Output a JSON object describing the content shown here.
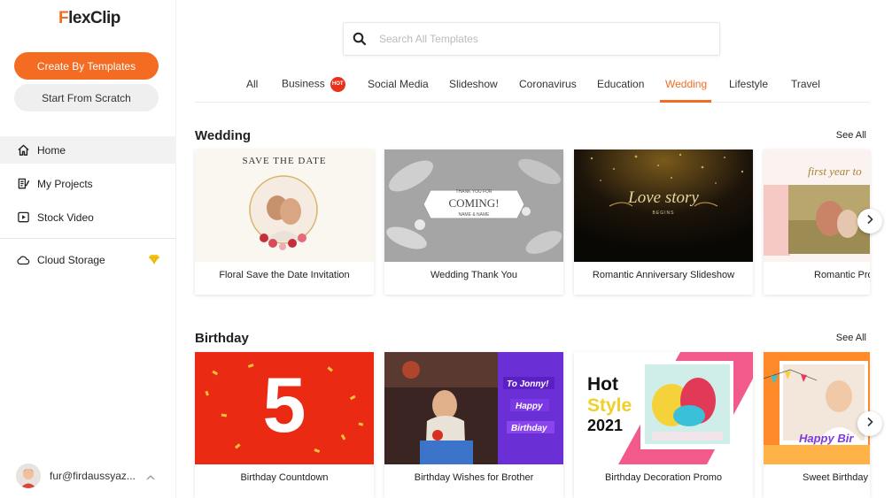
{
  "app": {
    "logo_initial": "F",
    "logo_rest": "lexClip"
  },
  "sidebar": {
    "create_button": "Create By Templates",
    "scratch_button": "Start From Scratch",
    "items": [
      {
        "label": "Home",
        "icon": "home-icon"
      },
      {
        "label": "My Projects",
        "icon": "projects-icon"
      },
      {
        "label": "Stock Video",
        "icon": "video-icon"
      },
      {
        "label": "Cloud Storage",
        "icon": "cloud-icon"
      }
    ],
    "user": "fur@firdaussyaz..."
  },
  "search": {
    "placeholder": "Search All Templates"
  },
  "tabs": [
    {
      "label": "All"
    },
    {
      "label": "Business",
      "badge": "HOT"
    },
    {
      "label": "Social Media"
    },
    {
      "label": "Slideshow"
    },
    {
      "label": "Coronavirus"
    },
    {
      "label": "Education"
    },
    {
      "label": "Wedding",
      "active": true
    },
    {
      "label": "Lifestyle"
    },
    {
      "label": "Travel"
    }
  ],
  "sections": [
    {
      "title": "Wedding",
      "see_all": "See All",
      "cards": [
        {
          "label": "Floral Save the Date Invitation",
          "thumb_text": "SAVE THE DATE"
        },
        {
          "label": "Wedding Thank You",
          "thumb_text": "COMING!",
          "thumb_small_top": "THANK YOU FOR",
          "thumb_small_bottom": "NAME & NAME"
        },
        {
          "label": "Romantic Anniversary Slideshow",
          "thumb_text": "Love story",
          "thumb_small_bottom": "BEGINS"
        },
        {
          "label": "Romantic Pro",
          "thumb_text": "first year to"
        }
      ]
    },
    {
      "title": "Birthday",
      "see_all": "See All",
      "cards": [
        {
          "label": "Birthday Countdown",
          "thumb_text": "5"
        },
        {
          "label": "Birthday Wishes for Brother",
          "thumb_lines": [
            "To Jonny!",
            "Happy",
            "Birthday"
          ]
        },
        {
          "label": "Birthday Decoration Promo",
          "thumb_lines": [
            "Hot",
            "Style",
            "2021"
          ]
        },
        {
          "label": "Sweet Birthday M",
          "thumb_text": "Happy Bir"
        }
      ]
    }
  ],
  "colors": {
    "accent": "#f36c22",
    "hot_badge": "#e8321c"
  }
}
